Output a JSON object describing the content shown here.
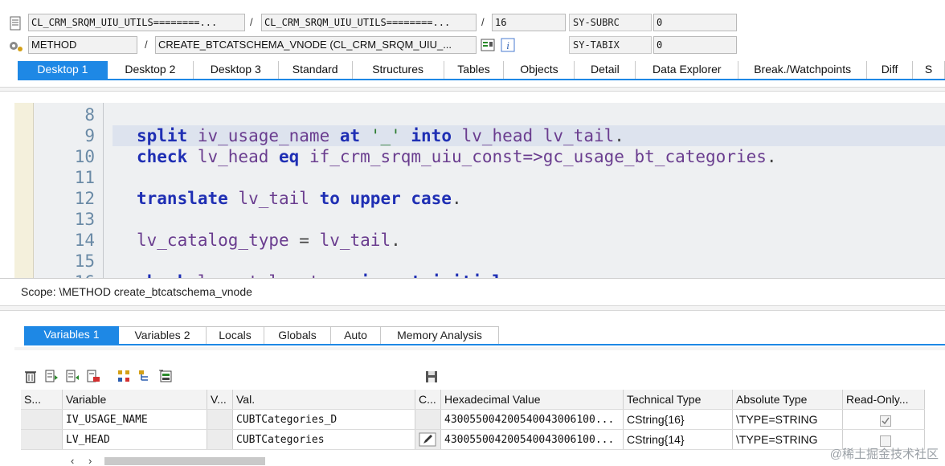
{
  "header": {
    "row1": {
      "program_a": "CL_CRM_SRQM_UIU_UTILS========...",
      "separator": "/",
      "program_b": "CL_CRM_SRQM_UIU_UTILS========...",
      "separator2": "/",
      "line_no": "16",
      "sysvar_label": "SY-SUBRC",
      "sysvar_value": "0"
    },
    "row2": {
      "type": "METHOD",
      "separator": "/",
      "method": "CREATE_BTCATSCHEMA_VNODE (CL_CRM_SRQM_UIU_...",
      "sysvar_label": "SY-TABIX",
      "sysvar_value": "0"
    }
  },
  "desktop_tabs": [
    "Desktop 1",
    "Desktop 2",
    "Desktop 3",
    "Standard",
    "Structures",
    "Tables",
    "Objects",
    "Detail",
    "Data Explorer",
    "Break./Watchpoints",
    "Diff",
    "S"
  ],
  "active_desktop_tab": 0,
  "code": {
    "lines": [
      {
        "no": "8",
        "tokens": []
      },
      {
        "no": "9",
        "tokens": [
          [
            "kw",
            "split"
          ],
          [
            "id",
            " iv_usage_name "
          ],
          [
            "kw",
            "at"
          ],
          [
            "str",
            " '_' "
          ],
          [
            "kw",
            "into"
          ],
          [
            "id",
            " lv_head lv_tail"
          ],
          [
            "op",
            "."
          ]
        ]
      },
      {
        "no": "10",
        "tokens": [
          [
            "kw",
            "check"
          ],
          [
            "id",
            " lv_head "
          ],
          [
            "kw",
            "eq"
          ],
          [
            "id",
            " if_crm_srqm_uiu_const=>gc_usage_bt_categories"
          ],
          [
            "op",
            "."
          ]
        ]
      },
      {
        "no": "11",
        "tokens": []
      },
      {
        "no": "12",
        "tokens": [
          [
            "kw",
            "translate"
          ],
          [
            "id",
            " lv_tail "
          ],
          [
            "kw",
            "to upper case"
          ],
          [
            "op",
            "."
          ]
        ]
      },
      {
        "no": "13",
        "tokens": []
      },
      {
        "no": "14",
        "tokens": [
          [
            "id",
            "lv_catalog_type "
          ],
          [
            "op",
            "="
          ],
          [
            "id",
            " lv_tail"
          ],
          [
            "op",
            "."
          ]
        ]
      },
      {
        "no": "15",
        "tokens": []
      },
      {
        "no": "16",
        "tokens": [
          [
            "kw",
            "check"
          ],
          [
            "id",
            " lv_catalog_type "
          ],
          [
            "kw",
            "is not initial"
          ],
          [
            "op",
            "."
          ]
        ]
      }
    ],
    "highlighted_line": "9"
  },
  "scope": "Scope: \\METHOD create_btcatschema_vnode",
  "variable_tabs": [
    "Variables 1",
    "Variables 2",
    "Locals",
    "Globals",
    "Auto",
    "Memory Analysis"
  ],
  "active_variable_tab": 0,
  "toolbar_icons": [
    "delete-icon",
    "insert-row-icon",
    "append-row-icon",
    "remove-row-icon",
    "hierarchy-icon",
    "tree-icon",
    "export-icon",
    "save-icon"
  ],
  "grid": {
    "columns": [
      "S...",
      "Variable",
      "V...",
      "Val.",
      "C...",
      "Hexadecimal Value",
      "Technical Type",
      "Absolute Type",
      "Read-Only..."
    ],
    "rows": [
      {
        "variable": "IV_USAGE_NAME",
        "value": "CUBTCategories_D",
        "hex": "430055004200540043006100...",
        "tech_type": "CString{16}",
        "abs_type": "\\TYPE=STRING",
        "read_only": true
      },
      {
        "variable": "LV_HEAD",
        "value": "CUBTCategories",
        "hex": "430055004200540043006100...",
        "tech_type": "CString{14}",
        "abs_type": "\\TYPE=STRING",
        "read_only": false
      }
    ]
  },
  "watermark": "@稀土掘金技术社区",
  "colors": {
    "accent": "#1e88e5",
    "keyword": "#1f2fb4",
    "identifier": "#6a3d8f",
    "string": "#2e7d32",
    "code_bg": "#eef0f2"
  }
}
